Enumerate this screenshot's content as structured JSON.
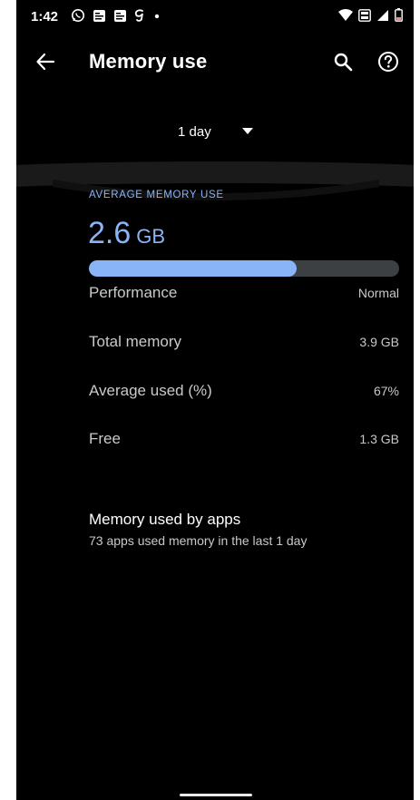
{
  "status_bar": {
    "time": "1:42",
    "left_icons": [
      "whatsapp-icon",
      "news-icon",
      "news-icon",
      "g-pay-icon",
      "dot-icon"
    ],
    "right_icons": [
      "wifi-icon",
      "volte-icon",
      "signal-icon",
      "battery-low-icon"
    ],
    "battery_color": "#f28b82"
  },
  "app_bar": {
    "title": "Memory use",
    "actions": [
      "search-icon",
      "help-icon"
    ],
    "back_icon": "arrow-back-icon"
  },
  "period": {
    "selected": "1 day",
    "caret_icon": "dropdown-caret-icon"
  },
  "stats": {
    "caption": "AVERAGE MEMORY USE",
    "average_value": "2.6",
    "average_unit": "GB",
    "usage_fraction": 0.67,
    "accent_color": "#8ab4f8",
    "rows": [
      {
        "label": "Performance",
        "value": "Normal"
      },
      {
        "label": "Total memory",
        "value": "3.9 GB"
      },
      {
        "label": "Average used (%)",
        "value": "67%"
      },
      {
        "label": "Free",
        "value": "1.3 GB"
      }
    ]
  },
  "apps": {
    "title": "Memory used by apps",
    "subtitle": "73 apps used memory in the last 1 day"
  }
}
